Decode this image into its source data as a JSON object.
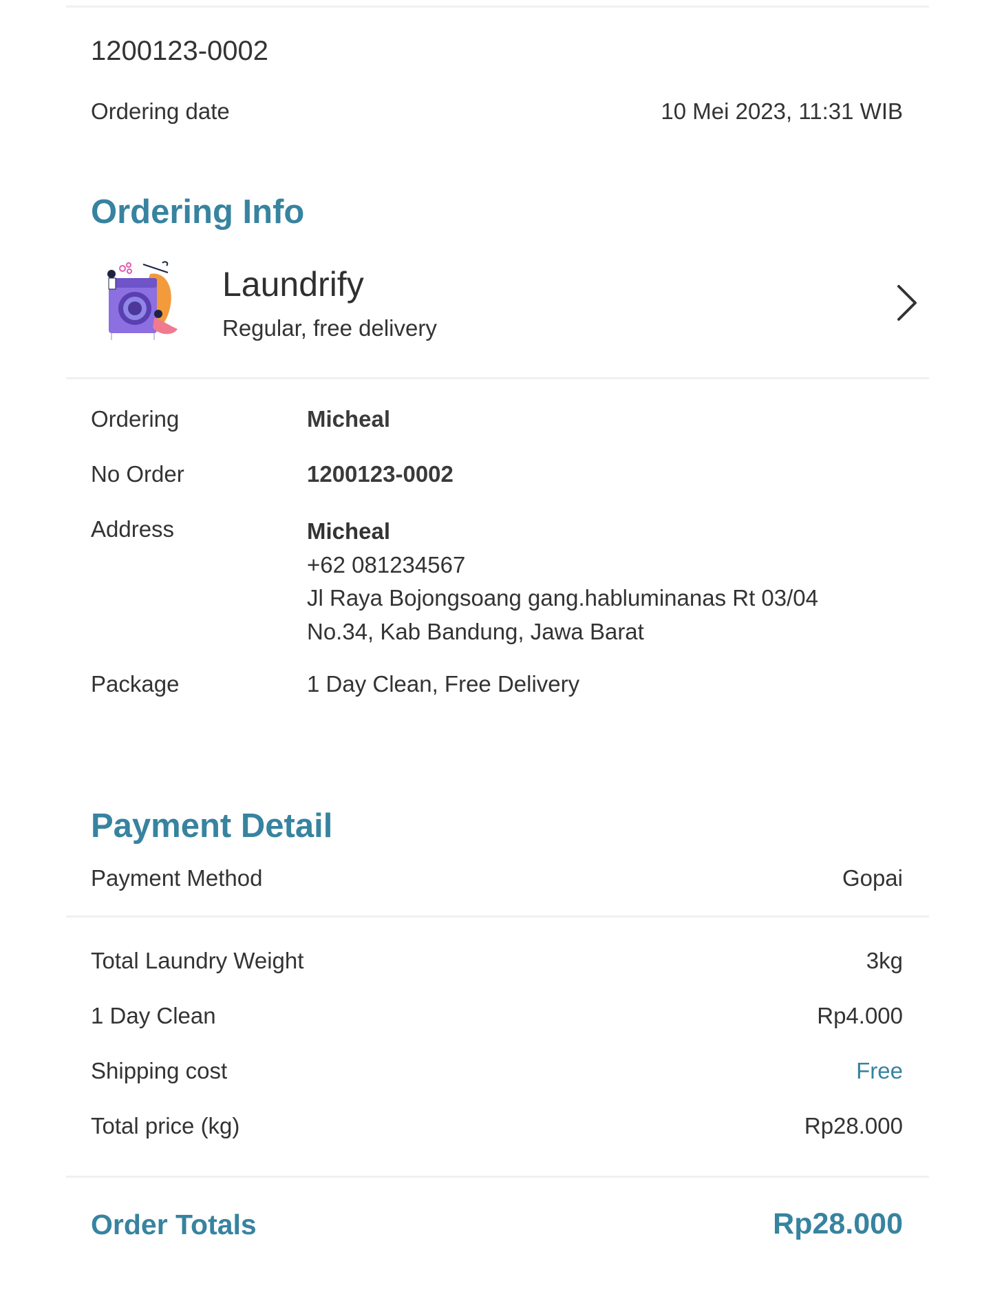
{
  "order": {
    "code": "1200123-0002",
    "date_label": "Ordering date",
    "date_value": "10 Mei 2023, 11:31 WIB"
  },
  "ordering_info": {
    "title": "Ordering Info",
    "provider": {
      "name": "Laundrify",
      "subtitle": "Regular, free delivery",
      "icon": "laundry-illustration",
      "chevron_icon": "chevron-right-icon"
    },
    "rows": {
      "ordering": {
        "label": "Ordering",
        "value": "Micheal"
      },
      "no_order": {
        "label": "No Order",
        "value": "1200123-0002"
      },
      "address": {
        "label": "Address",
        "name": "Micheal",
        "phone": "+62 081234567",
        "line1": "Jl Raya Bojongsoang gang.habluminanas Rt 03/04",
        "line2": "No.34, Kab Bandung, Jawa Barat"
      },
      "package": {
        "label": "Package",
        "value": "1 Day Clean, Free Delivery"
      }
    }
  },
  "payment_detail": {
    "title": "Payment Detail",
    "method_label": "Payment Method",
    "method_value": "Gopai",
    "rows": {
      "weight": {
        "label": "Total Laundry Weight",
        "value": "3kg"
      },
      "clean": {
        "label": "1 Day Clean",
        "value": "Rp4.000"
      },
      "shipping": {
        "label": "Shipping cost",
        "value": "Free"
      },
      "total_price": {
        "label": "Total price (kg)",
        "value": "Rp28.000"
      }
    }
  },
  "totals": {
    "label": "Order Totals",
    "value": "Rp28.000"
  },
  "colors": {
    "accent": "#3783a0",
    "text": "#333333",
    "divider": "#f0f0f0"
  }
}
